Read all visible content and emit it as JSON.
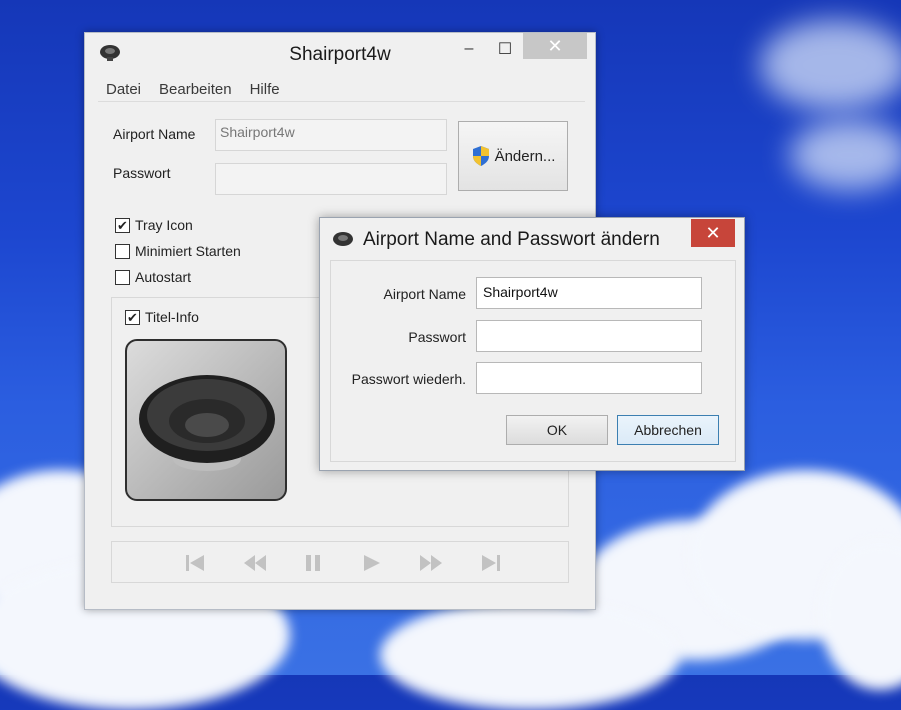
{
  "main_window": {
    "title": "Shairport4w",
    "controls": {
      "minimize": "–",
      "maximize": "☐",
      "close": "✕"
    },
    "menu": [
      "Datei",
      "Bearbeiten",
      "Hilfe"
    ],
    "airport_name_label": "Airport Name",
    "airport_name_value": "Shairport4w",
    "password_label": "Passwort",
    "password_value": "",
    "change_button": "Ändern...",
    "tray_icon_label": "Tray Icon",
    "tray_icon_checked": true,
    "start_minimized_label": "Minimiert Starten",
    "start_minimized_checked": false,
    "autostart_label": "Autostart",
    "autostart_checked": false,
    "title_info_label": "Titel-Info",
    "title_info_checked": true,
    "playback_icons": [
      "skip-back-icon",
      "rewind-icon",
      "pause-icon",
      "play-icon",
      "fast-forward-icon",
      "skip-forward-icon"
    ]
  },
  "dialog": {
    "title": "Airport Name and Passwort ändern",
    "close": "✕",
    "airport_name_label": "Airport Name",
    "airport_name_value": "Shairport4w",
    "password_label": "Passwort",
    "password_value": "",
    "password_repeat_label": "Passwort wiederh.",
    "password_repeat_value": "",
    "ok_button": "OK",
    "cancel_button": "Abbrechen"
  },
  "colors": {
    "desktop_sky": "#1d47d0",
    "close_active": "#c7453a",
    "default_button_border": "#3c7fb1"
  }
}
